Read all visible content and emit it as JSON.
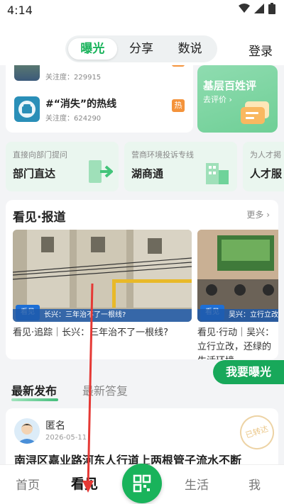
{
  "status": {
    "time": "4:14"
  },
  "topbar": {
    "tabs": [
      {
        "label": "曝光",
        "active": true
      },
      {
        "label": "分享",
        "active": false
      },
      {
        "label": "数说",
        "active": false
      }
    ],
    "login_label": "登录"
  },
  "hot_list": {
    "items": [
      {
        "title": "",
        "attention_label": "关注度：229915",
        "badge": "热"
      },
      {
        "title": "#“消失”的热线",
        "attention_label": "关注度：624290",
        "badge": "热"
      }
    ]
  },
  "evaluation_card": {
    "title": "基层百姓评",
    "subtitle": "去评价 ›"
  },
  "services": [
    {
      "sub": "直接向部门提问",
      "main": "部门直达"
    },
    {
      "sub": "营商环境投诉专线",
      "main": "湖商通"
    },
    {
      "sub": "为人才掲",
      "main": "人才服"
    }
  ],
  "report": {
    "title": "看见·报道",
    "more_label": "更多",
    "items": [
      {
        "strip_text": "长兴：三年治不了一根线?",
        "logo_text": "看见",
        "caption": "看见·追踪｜长兴：三年治不了一根线?"
      },
      {
        "strip_text": "吴兴：立行立改",
        "logo_text": "看见",
        "caption": "看见·行动｜吴兴：立行立改，还绿的生活环境"
      }
    ]
  },
  "fab_label": "我要曝光",
  "feed_tabs": [
    {
      "label": "最新发布",
      "active": true
    },
    {
      "label": "最新答复",
      "active": false
    }
  ],
  "post": {
    "author": "匿名",
    "date": "2026-05-11",
    "title": "南浔区嘉业路河东人行道上两根管子流水不断",
    "stamp": "已转达"
  },
  "bottom_nav": [
    {
      "label": "首页",
      "active": false
    },
    {
      "label": "看见",
      "active": true
    },
    {
      "label": "生活",
      "active": false
    },
    {
      "label": "我",
      "active": false
    }
  ],
  "colors": {
    "brand_green": "#19b35b",
    "hot_badge": "#f4933b",
    "annotation_arrow": "#e53935"
  }
}
